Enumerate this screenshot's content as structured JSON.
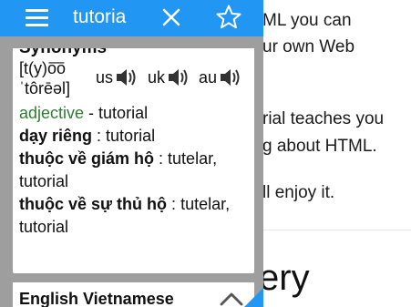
{
  "background_page": {
    "lines": [
      "ML you can",
      "ur own Web",
      "rial teaches you",
      "g about HTML.",
      "ll enjoy it."
    ],
    "heading": "ery"
  },
  "topbar": {
    "search_value": "tutoria",
    "accent_color": "#2196f3",
    "menu_icon": "hamburger-menu-icon",
    "clear_icon": "close-icon",
    "favorite_icon": "star-outline-icon"
  },
  "entry": {
    "section_title": "Synonyms",
    "phonetic": "[t(y)o͞o ˈtôrēəl]",
    "pronunciations": [
      {
        "label": "us",
        "icon": "speaker-icon"
      },
      {
        "label": "uk",
        "icon": "speaker-icon"
      },
      {
        "label": "au",
        "icon": "speaker-icon"
      }
    ],
    "definitions": [
      {
        "term": "adjective",
        "sep": " - ",
        "value": "tutorial"
      },
      {
        "term": "dạy riêng",
        "sep": " : ",
        "value": "tutorial"
      },
      {
        "term": "thuộc về giám hộ",
        "sep": " : ",
        "value": "tutelar, tutorial"
      },
      {
        "term": "thuộc về sự thủ hộ",
        "sep": " : ",
        "value": "tutelar, tutorial"
      }
    ]
  },
  "second_card": {
    "title": "English Vietnamese",
    "toggle_icon": "chevron-up-icon"
  }
}
